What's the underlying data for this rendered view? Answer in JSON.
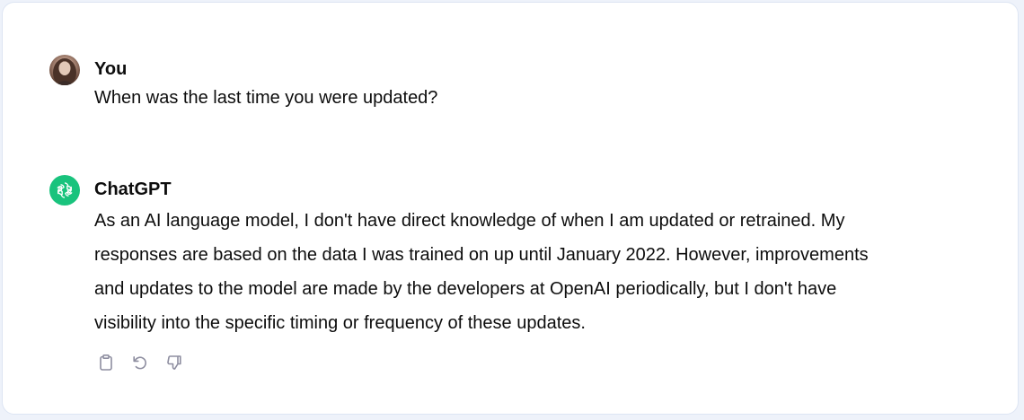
{
  "conversation": {
    "user": {
      "author": "You",
      "text": "When was the last time you were updated?"
    },
    "assistant": {
      "author": "ChatGPT",
      "text": "As an AI language model, I don't have direct knowledge of when I am updated or retrained. My\nresponses are based on the data I was trained on up until January 2022. However, improvements\nand updates to the model are made by the developers at OpenAI periodically, but I don't have\nvisibility into the specific timing or frequency of these updates."
    },
    "actions": [
      {
        "icon": "clipboard-icon"
      },
      {
        "icon": "regenerate-icon"
      },
      {
        "icon": "thumbs-down-icon"
      }
    ]
  },
  "colors": {
    "background": "#eef2fa",
    "card": "#ffffff",
    "brand_green": "#19c37d",
    "text": "#0d0d0d",
    "icon": "#8e8ea0"
  }
}
